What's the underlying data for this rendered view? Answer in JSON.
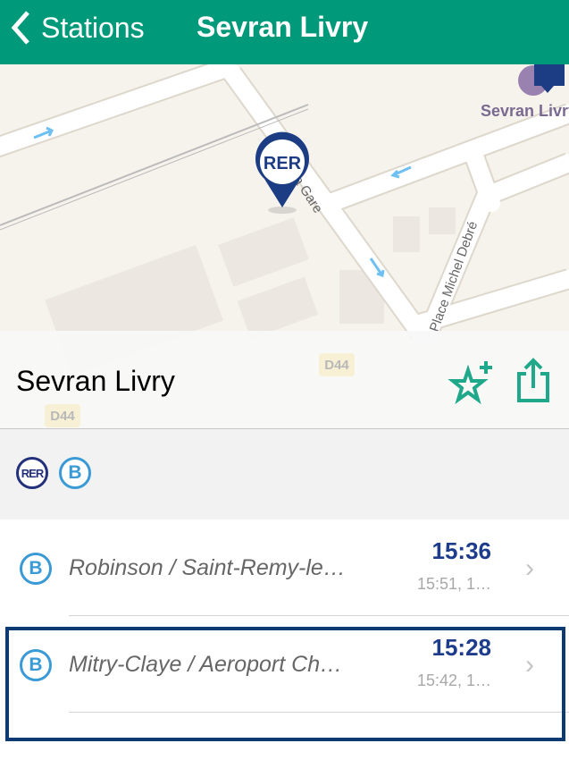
{
  "navbar": {
    "back_label": "Stations",
    "title": "Sevran Livry",
    "color": "#009a7a"
  },
  "map": {
    "street_labels": [
      "Rue de la Gare",
      "Place Michel Debré"
    ],
    "road_signs": [
      "D44",
      "D44"
    ],
    "poi_label": "Sevran Livry",
    "pin_label": "RER"
  },
  "station": {
    "name": "Sevran Livry",
    "favorite_icon": "star-plus-icon",
    "share_icon": "share-icon"
  },
  "lines": [
    {
      "label": "RER",
      "color": "#23307c"
    },
    {
      "label": "B",
      "color": "#3a9ad6"
    }
  ],
  "departures": [
    {
      "line": "B",
      "destination": "Robinson / Saint-Remy-le…",
      "next": "15:36",
      "following": "15:51, 1…"
    },
    {
      "line": "B",
      "destination": "Mitry-Claye / Aeroport Ch…",
      "next": "15:28",
      "following": "15:42, 1…",
      "selected": true
    }
  ]
}
